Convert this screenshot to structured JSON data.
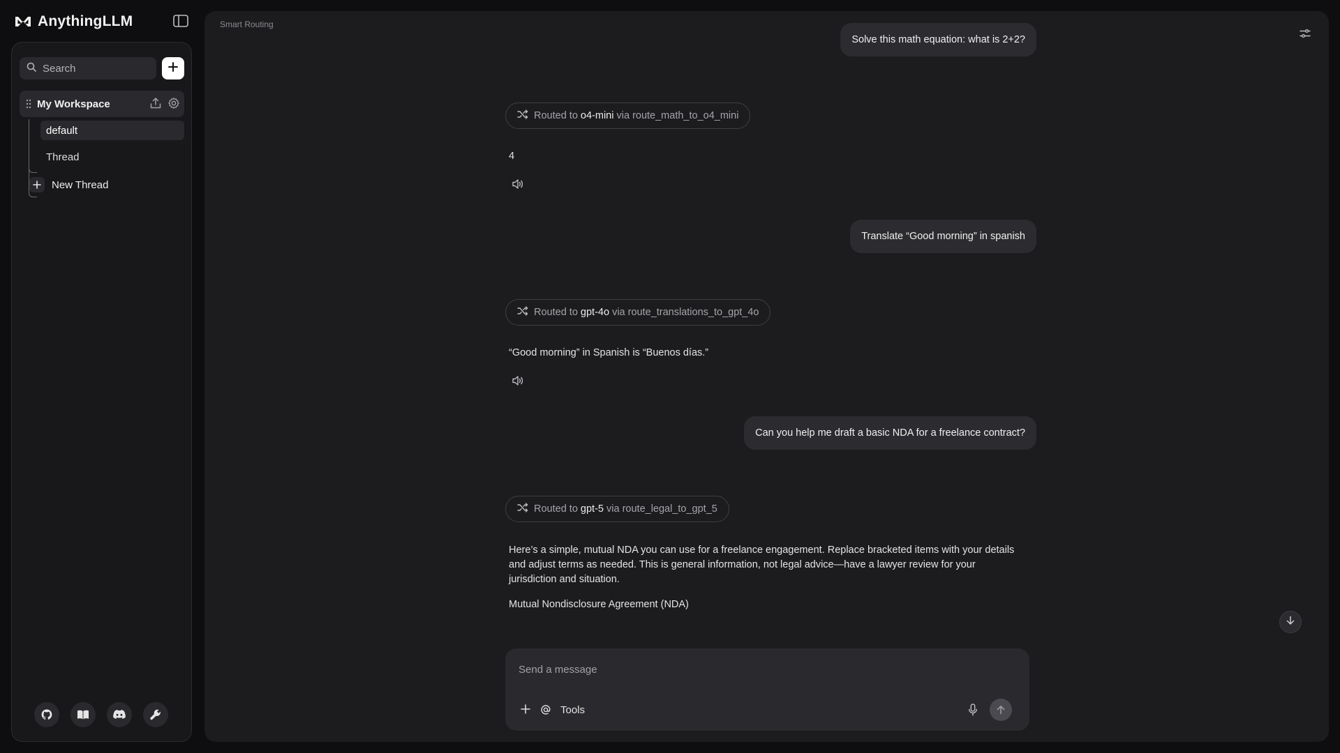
{
  "app": {
    "name": "AnythingLLM"
  },
  "sidebar": {
    "search_placeholder": "Search",
    "workspace": {
      "name": "My Workspace"
    },
    "threads": [
      {
        "label": "default",
        "active": true
      },
      {
        "label": "Thread",
        "active": false
      }
    ],
    "new_thread_label": "New Thread",
    "footer_icons": [
      "github-icon",
      "docs-book-icon",
      "discord-icon",
      "wrench-icon"
    ]
  },
  "main": {
    "title": "Smart Routing",
    "messages": [
      {
        "user": "Solve this math equation: what is 2+2?",
        "route": {
          "prefix": "Routed to",
          "model": "o4-mini",
          "via": "via route_math_to_o4_mini"
        },
        "reply": "4"
      },
      {
        "user": "Translate “Good morning” in spanish",
        "route": {
          "prefix": "Routed to",
          "model": "gpt-4o",
          "via": "via route_translations_to_gpt_4o"
        },
        "reply": "“Good morning” in Spanish is “Buenos días.”"
      },
      {
        "user": "Can you help me draft a basic NDA for a freelance contract?",
        "route": {
          "prefix": "Routed to",
          "model": "gpt-5",
          "via": "via route_legal_to_gpt_5"
        },
        "reply_paragraphs": [
          "Here’s a simple, mutual NDA you can use for a freelance engagement. Replace bracketed items with your details and adjust terms as needed. This is general information, not legal advice—have a lawyer review for your jurisdiction and situation.",
          "Mutual Nondisclosure Agreement (NDA)"
        ]
      }
    ]
  },
  "composer": {
    "placeholder": "Send a message",
    "tools_label": "Tools"
  },
  "colors": {
    "background": "#0e0e10",
    "sidebar": "#18181b",
    "panel": "#1c1c1f",
    "bubble": "#2c2c30",
    "text": "#e4e4e4",
    "muted": "#a4a4aa"
  }
}
